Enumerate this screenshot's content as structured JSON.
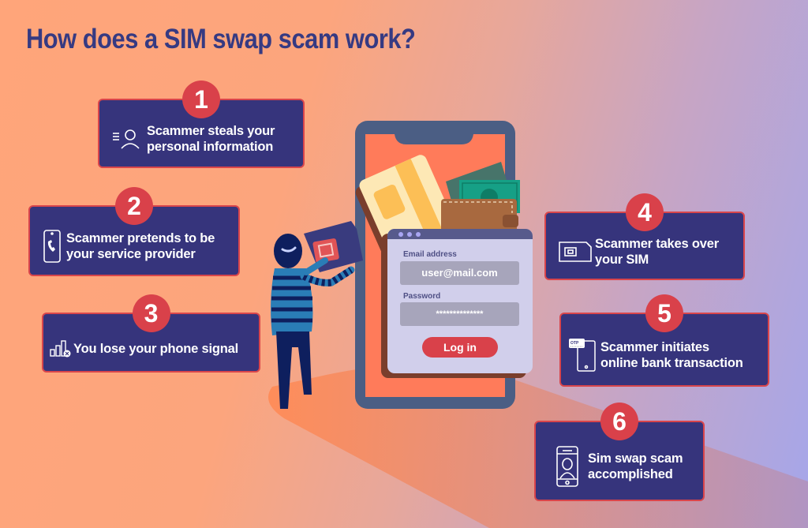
{
  "title": "How does a SIM swap scam work?",
  "colors": {
    "title": "#363a82",
    "card_bg": "#36347c",
    "badge": "#d9414a",
    "phone_frame": "#4b5e84",
    "phone_screen": "#ff7b5a"
  },
  "steps": [
    {
      "number": "1",
      "icon": "person-info-icon",
      "lines": [
        "Scammer steals your",
        "personal information"
      ]
    },
    {
      "number": "2",
      "icon": "phone-call-icon",
      "lines": [
        "Scammer pretends to be",
        "your service provider"
      ]
    },
    {
      "number": "3",
      "icon": "no-signal-icon",
      "lines": [
        "You lose your phone signal"
      ]
    },
    {
      "number": "4",
      "icon": "sim-card-icon",
      "lines": [
        "Scammer takes over",
        "your SIM"
      ]
    },
    {
      "number": "5",
      "icon": "otp-phone-icon",
      "lines": [
        "Scammer initiates",
        "online bank transaction"
      ]
    },
    {
      "number": "6",
      "icon": "phone-user-icon",
      "lines": [
        "Sim swap scam",
        "accomplished"
      ]
    }
  ],
  "login": {
    "email_label": "Email address",
    "email_value": "user@mail.com",
    "password_label": "Password",
    "password_value": "**************",
    "button_label": "Log in"
  }
}
